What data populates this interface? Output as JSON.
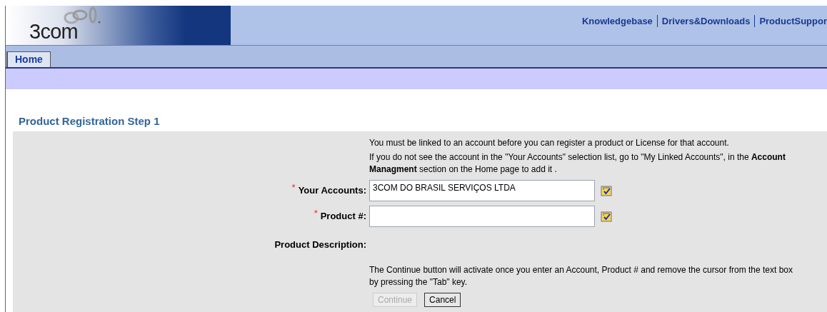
{
  "header": {
    "logo": "3com",
    "links": [
      "Knowledgebase",
      "Drivers&Downloads",
      "ProductSuppor"
    ]
  },
  "tabs": [
    {
      "label": "Home",
      "selected": true
    }
  ],
  "page": {
    "title": "Product Registration Step 1",
    "intro": [
      "You must be linked to an account before you can register a product or License for that account.",
      "If you do not see the account in the \"Your Accounts\" selection list, go to \"My Linked Accounts\", in the **Account Managment** section on the Home page to add it ."
    ],
    "fields": [
      {
        "label": "Your Accounts:",
        "required_mark": "*",
        "value": "3COM DO BRASIL SERVIÇOS LTDA"
      },
      {
        "label": "Product #:",
        "required_mark": "*"
      }
    ],
    "description_label": "Product Description:",
    "note": "The Continue button will activate once you enter an Account, Product # and remove the cursor from the text box by pressing the \"Tab\" key.",
    "buttons": [
      {
        "label": "Continue",
        "disabled": true
      },
      {
        "label": "Cancel",
        "disabled": false
      }
    ]
  }
}
